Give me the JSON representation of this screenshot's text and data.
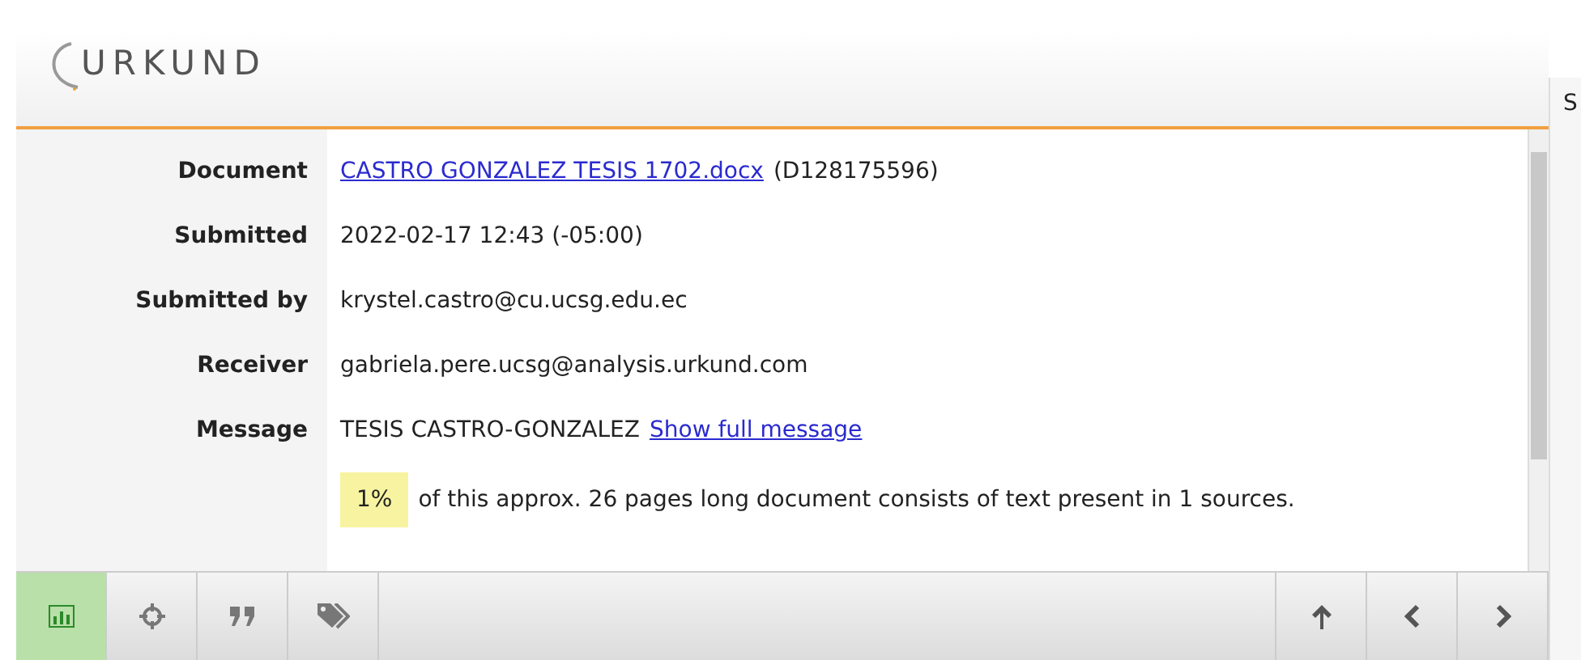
{
  "header": {
    "logo": "URKUND"
  },
  "side_panel": {
    "tab_label": "S"
  },
  "details": [
    {
      "label": "Document",
      "kind": "link",
      "value": "CASTRO GONZALEZ TESIS 1702.docx",
      "extra": "(D128175596)"
    },
    {
      "label": "Submitted",
      "kind": "text",
      "value": "2022-02-17 12:43 (-05:00)"
    },
    {
      "label": "Submitted by",
      "kind": "text",
      "value": "krystel.castro@cu.ucsg.edu.ec"
    },
    {
      "label": "Receiver",
      "kind": "text",
      "value": "gabriela.pere.ucsg@analysis.urkund.com"
    },
    {
      "label": "Message",
      "kind": "message",
      "value": "TESIS CASTRO-GONZALEZ",
      "link": "Show full message"
    }
  ],
  "summary": {
    "percent": "1%",
    "text": "of this approx. 26 pages long document consists of text present in 1 sources."
  },
  "toolbar": {
    "left": [
      {
        "kind": "chart",
        "selected": true
      },
      {
        "kind": "target",
        "selected": false
      },
      {
        "kind": "quote",
        "selected": false
      },
      {
        "kind": "tags",
        "selected": false
      }
    ],
    "right": [
      {
        "kind": "up"
      },
      {
        "kind": "prev"
      },
      {
        "kind": "next"
      }
    ]
  }
}
